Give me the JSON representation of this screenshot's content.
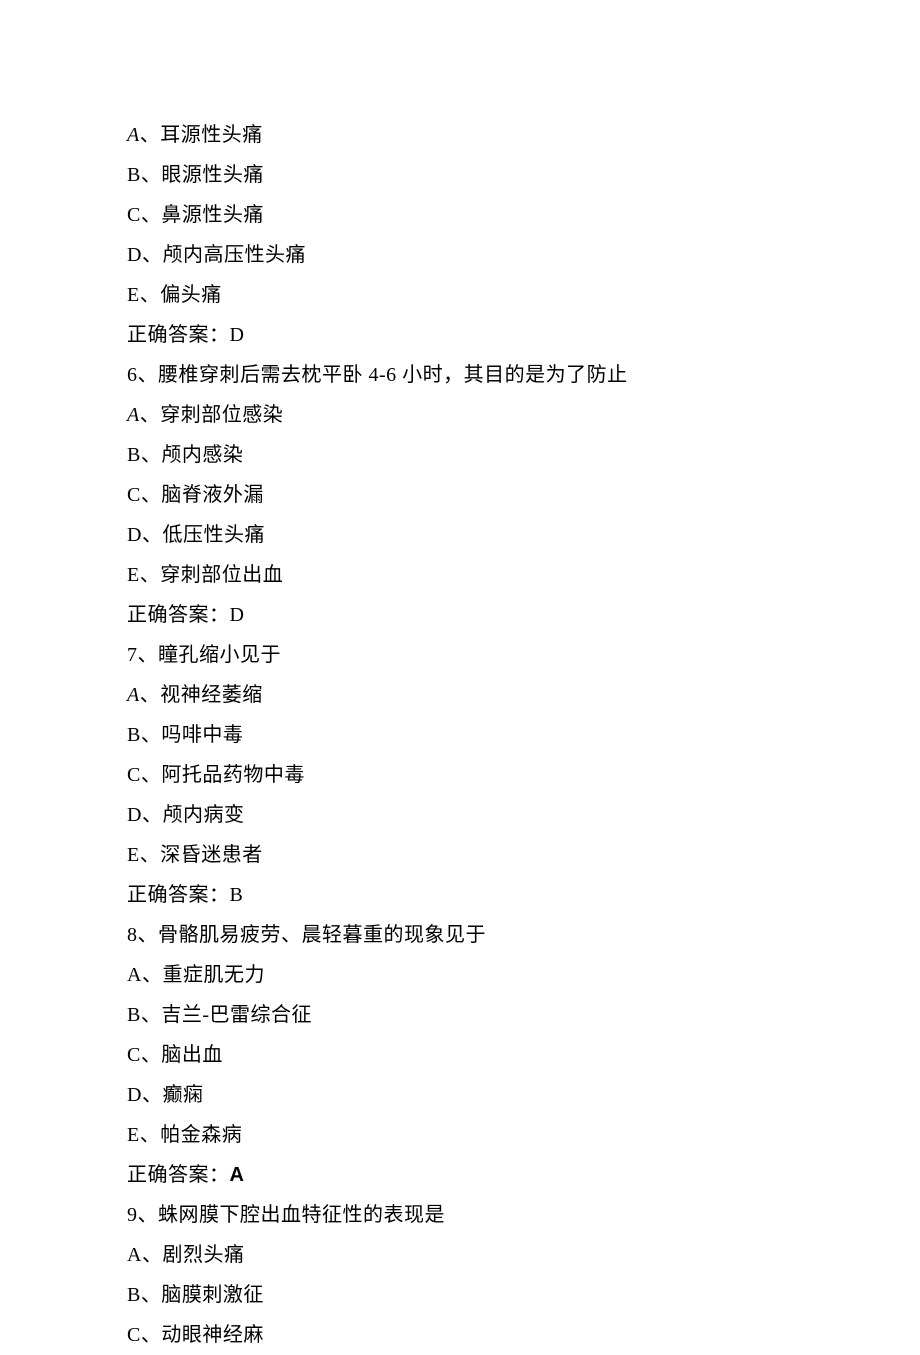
{
  "lines": [
    {
      "prefix_italic": "A",
      "text": "、耳源性头痛"
    },
    {
      "text": "B、眼源性头痛"
    },
    {
      "text": "C、鼻源性头痛"
    },
    {
      "text": "D、颅内高压性头痛"
    },
    {
      "text": "E、偏头痛"
    },
    {
      "text": "正确答案：D"
    },
    {
      "text": "6、腰椎穿刺后需去枕平卧 4-6 小时，其目的是为了防止"
    },
    {
      "prefix_italic": "A",
      "text": "、穿刺部位感染"
    },
    {
      "text": "B、颅内感染"
    },
    {
      "text": "C、脑脊液外漏"
    },
    {
      "text": "D、低压性头痛"
    },
    {
      "text": "E、穿刺部位出血"
    },
    {
      "text": "正确答案：D"
    },
    {
      "text": "7、瞳孔缩小见于"
    },
    {
      "prefix_italic": "A",
      "text": "、视神经萎缩"
    },
    {
      "text": "B、吗啡中毒"
    },
    {
      "text": "C、阿托品药物中毒"
    },
    {
      "text": "D、颅内病变"
    },
    {
      "text": "E、深昏迷患者"
    },
    {
      "text": "正确答案：B"
    },
    {
      "text": "8、骨骼肌易疲劳、晨轻暮重的现象见于"
    },
    {
      "text": "A、重症肌无力"
    },
    {
      "text": "B、吉兰-巴雷综合征"
    },
    {
      "text": "C、脑出血"
    },
    {
      "text": "D、癫痫"
    },
    {
      "text": "E、帕金森病"
    },
    {
      "text_prefix": "正确答案：",
      "text_bold": "A"
    },
    {
      "text": "9、蛛网膜下腔出血特征性的表现是"
    },
    {
      "text": "A、剧烈头痛"
    },
    {
      "text": "B、脑膜刺激征"
    },
    {
      "text": "C、动眼神经麻"
    }
  ]
}
